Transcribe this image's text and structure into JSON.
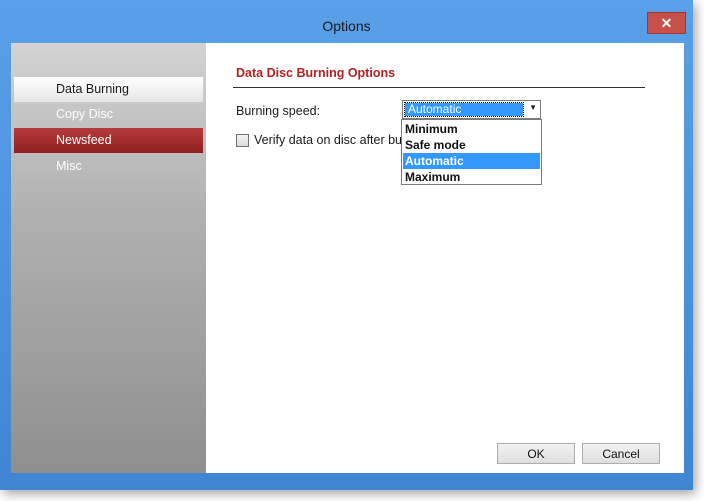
{
  "window": {
    "title": "Options",
    "close_glyph": "✕"
  },
  "sidebar": {
    "items": [
      {
        "label": "Data Burning"
      },
      {
        "label": "Copy Disc"
      },
      {
        "label": "Newsfeed"
      },
      {
        "label": "Misc"
      }
    ]
  },
  "main": {
    "section_title": "Data Disc Burning Options",
    "burning_speed_label": "Burning speed:",
    "burning_speed_value": "Automatic",
    "burning_speed_options": [
      "Minimum",
      "Safe mode",
      "Automatic",
      "Maximum"
    ],
    "verify_label": "Verify data on disc after burnir"
  },
  "buttons": {
    "ok": "OK",
    "cancel": "Cancel"
  },
  "colors": {
    "accent_red": "#b22222",
    "selection_blue": "#3399ff",
    "titlebar_blue": "#4a90d9"
  }
}
